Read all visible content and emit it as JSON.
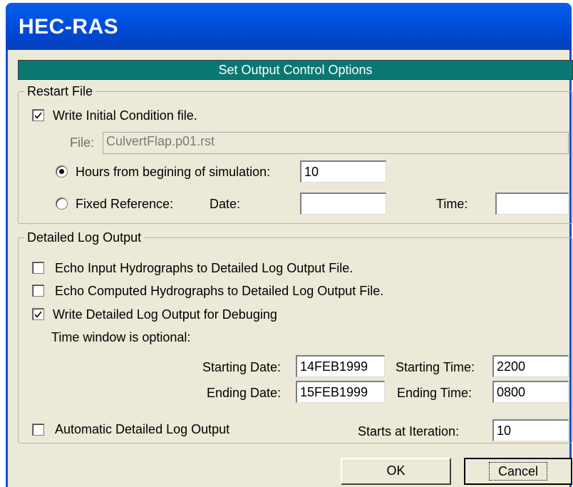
{
  "window": {
    "title": "HEC-RAS"
  },
  "banner": "Set Output Control Options",
  "restart": {
    "legend": "Restart File",
    "write_ic_label": "Write Initial Condition file.",
    "write_ic_checked": true,
    "file_label": "File:",
    "file_value": "CulvertFlap.p01.rst",
    "hours_label": "Hours from begining of simulation:",
    "hours_value": "10",
    "hours_selected": true,
    "fixed_label": "Fixed Reference:",
    "date_label": "Date:",
    "date_value": "",
    "time_label": "Time:",
    "time_value": ""
  },
  "log": {
    "legend": "Detailed Log Output",
    "echo_input_label": "Echo Input Hydrographs to Detailed Log Output File.",
    "echo_input_checked": false,
    "echo_computed_label": "Echo Computed Hydrographs to Detailed Log Output File.",
    "echo_computed_checked": false,
    "write_debug_label": "Write Detailed Log Output for Debuging",
    "write_debug_checked": true,
    "time_window_label": "Time window is optional:",
    "start_date_label": "Starting Date:",
    "start_date_value": "14FEB1999",
    "start_time_label": "Starting Time:",
    "start_time_value": "2200",
    "end_date_label": "Ending Date:",
    "end_date_value": "15FEB1999",
    "end_time_label": "Ending Time:",
    "end_time_value": "0800",
    "auto_label": "Automatic Detailed Log Output",
    "auto_checked": false,
    "starts_label": "Starts at Iteration:",
    "starts_value": "10"
  },
  "buttons": {
    "ok": "OK",
    "cancel": "Cancel"
  }
}
